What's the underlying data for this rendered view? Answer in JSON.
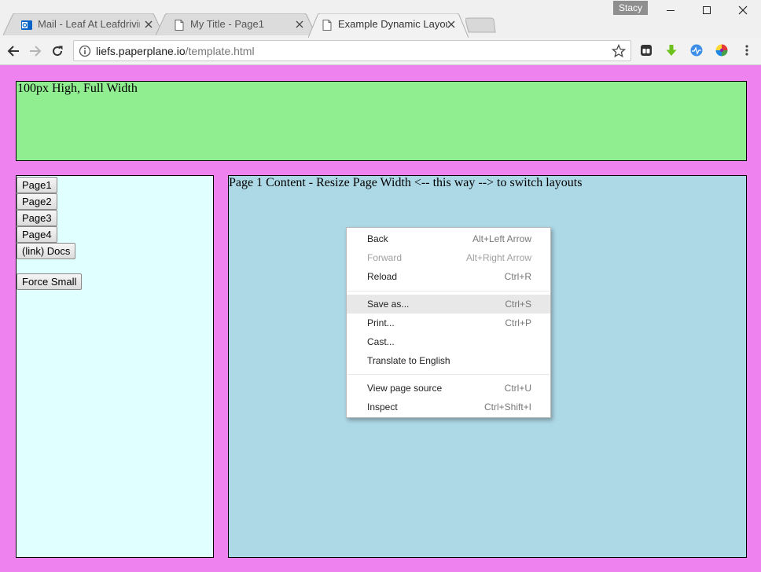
{
  "window": {
    "user_name": "Stacy",
    "tabs": [
      {
        "label": "Mail - Leaf At Leafdriving",
        "icon": "outlook-icon",
        "active": false
      },
      {
        "label": "My Title - Page1",
        "icon": "page-icon",
        "active": false
      },
      {
        "label": "Example Dynamic Layout",
        "icon": "page-icon",
        "active": true
      }
    ]
  },
  "toolbar": {
    "url_host": "liefs.paperplane.io",
    "url_path": "/template.html",
    "extensions": [
      "tab-manager-icon",
      "download-arrow-icon",
      "pulse-icon",
      "color-wheel-icon"
    ]
  },
  "page": {
    "header_text": "100px High, Full Width",
    "nav_buttons": [
      "Page1",
      "Page2",
      "Page3",
      "Page4",
      "(link) Docs"
    ],
    "force_small_label": "Force Small",
    "content_text": "Page 1 Content - Resize Page Width <-- this way --> to switch layouts"
  },
  "context_menu": {
    "groups": [
      [
        {
          "label": "Back",
          "shortcut": "Alt+Left Arrow",
          "disabled": false
        },
        {
          "label": "Forward",
          "shortcut": "Alt+Right Arrow",
          "disabled": true
        },
        {
          "label": "Reload",
          "shortcut": "Ctrl+R",
          "disabled": false
        }
      ],
      [
        {
          "label": "Save as...",
          "shortcut": "Ctrl+S",
          "disabled": false,
          "hovered": true
        },
        {
          "label": "Print...",
          "shortcut": "Ctrl+P",
          "disabled": false
        },
        {
          "label": "Cast...",
          "shortcut": "",
          "disabled": false
        },
        {
          "label": "Translate to English",
          "shortcut": "",
          "disabled": false
        }
      ],
      [
        {
          "label": "View page source",
          "shortcut": "Ctrl+U",
          "disabled": false
        },
        {
          "label": "Inspect",
          "shortcut": "Ctrl+Shift+I",
          "disabled": false
        }
      ]
    ]
  },
  "colors": {
    "page_background": "#ee82ee",
    "header_background": "#90ee90",
    "sidebar_background": "#e0ffff",
    "content_background": "#add8e6"
  }
}
